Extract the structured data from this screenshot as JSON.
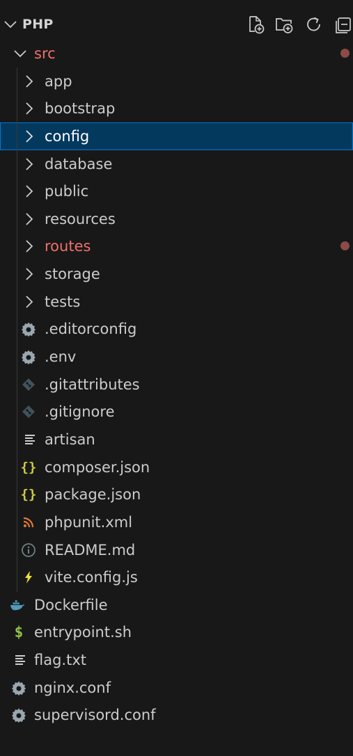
{
  "explorer": {
    "title": "PHP",
    "toolbar": {
      "new_file": "new-file-icon",
      "new_folder": "new-folder-icon",
      "refresh": "refresh-icon",
      "collapse_all": "collapse-all-icon"
    }
  },
  "tree": {
    "src": {
      "label": "src",
      "modified": true,
      "expanded": true
    },
    "src_children": [
      {
        "label": "app",
        "type": "folder"
      },
      {
        "label": "bootstrap",
        "type": "folder"
      },
      {
        "label": "config",
        "type": "folder",
        "selected": true
      },
      {
        "label": "database",
        "type": "folder"
      },
      {
        "label": "public",
        "type": "folder"
      },
      {
        "label": "resources",
        "type": "folder"
      },
      {
        "label": "routes",
        "type": "folder",
        "modified": true
      },
      {
        "label": "storage",
        "type": "folder"
      },
      {
        "label": "tests",
        "type": "folder"
      },
      {
        "label": ".editorconfig",
        "icon": "gear-icon"
      },
      {
        "label": ".env",
        "icon": "gear-icon"
      },
      {
        "label": ".gitattributes",
        "icon": "git-icon"
      },
      {
        "label": ".gitignore",
        "icon": "git-icon"
      },
      {
        "label": "artisan",
        "icon": "text-lines-icon"
      },
      {
        "label": "composer.json",
        "icon": "json-braces-icon"
      },
      {
        "label": "package.json",
        "icon": "json-braces-icon"
      },
      {
        "label": "phpunit.xml",
        "icon": "rss-icon"
      },
      {
        "label": "README.md",
        "icon": "info-icon"
      },
      {
        "label": "vite.config.js",
        "icon": "lightning-icon"
      }
    ],
    "root_files": [
      {
        "label": "Dockerfile",
        "icon": "docker-whale-icon"
      },
      {
        "label": "entrypoint.sh",
        "icon": "dollar-icon"
      },
      {
        "label": "flag.txt",
        "icon": "text-lines-icon"
      },
      {
        "label": "nginx.conf",
        "icon": "gear-icon"
      },
      {
        "label": "supervisord.conf",
        "icon": "gear-icon"
      }
    ]
  },
  "colors": {
    "background": "#181818",
    "text": "#cccccc",
    "modified": "#f0706a",
    "modified_dot": "#8c4a48",
    "selection_bg": "#04395e",
    "selection_border": "#0078d4",
    "json_icon": "#cbcb41",
    "rss_icon": "#e37933",
    "info_icon": "#6d8086",
    "lightning_icon": "#f0e040",
    "docker_icon": "#519aba",
    "shell_icon": "#8dc149"
  }
}
